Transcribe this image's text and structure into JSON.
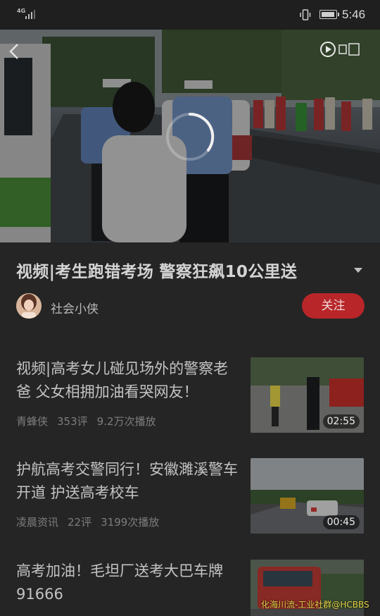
{
  "status_bar": {
    "network": "4G",
    "time": "5:46",
    "icons": [
      "signal-icon",
      "vibrate-icon",
      "battery-icon"
    ]
  },
  "video": {
    "icons": [
      "back-arrow-icon",
      "watermark-logo-icon",
      "loading-spinner-icon"
    ]
  },
  "title": "视频|考生跑错考场 警察狂飙10公里送",
  "author": {
    "name": "社会小侠",
    "follow_label": "关注"
  },
  "related": [
    {
      "title": "视频|高考女儿碰见场外的警察老爸 父女相拥加油看哭网友！",
      "source": "青蜂侠",
      "comments": "353评",
      "plays": "9.2万次播放",
      "duration": "02:55"
    },
    {
      "title": "护航高考交警同行！安徽濉溪警车开道 护送高考校车",
      "source": "凌晨资讯",
      "comments": "22评",
      "plays": "3199次播放",
      "duration": "00:45"
    },
    {
      "title": "高考加油！毛坦厂送考大巴车牌91666",
      "source": "",
      "comments": "",
      "plays": "",
      "duration": ""
    }
  ],
  "page_watermark": "化海川流-工业社群@HCBBS",
  "colors": {
    "background": "#252525",
    "follow_button": "#b8262a",
    "watermark_text": "#e6d34a"
  }
}
